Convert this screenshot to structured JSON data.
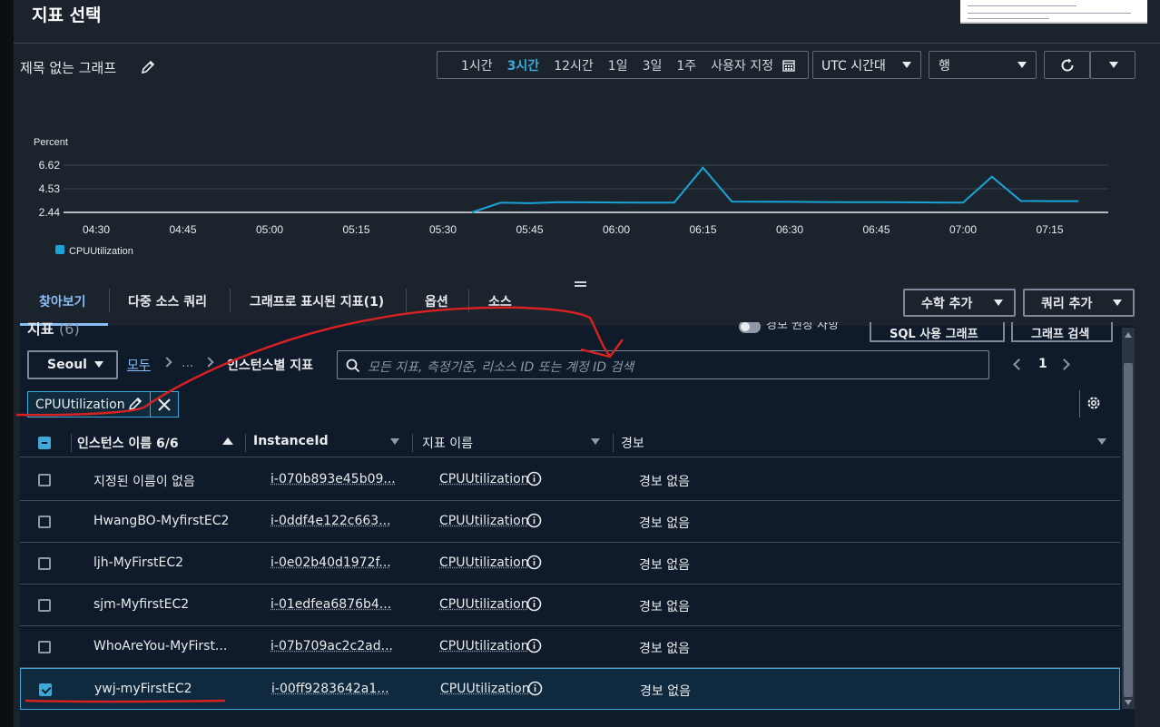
{
  "page": {
    "title": "지표 선택"
  },
  "graph": {
    "title": "제목 없는 그래프"
  },
  "time_ranges": [
    "1시간",
    "3시간",
    "12시간",
    "1일",
    "3일",
    "1주",
    "사용자 지정"
  ],
  "time_range_active": "3시간",
  "timezone": "UTC 시간대",
  "view_type": "행",
  "chart_data": {
    "type": "line",
    "ylabel": "Percent",
    "y_ticks": [
      "2.44",
      "4.53",
      "6.62"
    ],
    "ylim": [
      2.44,
      6.62
    ],
    "x_ticks": [
      "04:30",
      "04:45",
      "05:00",
      "05:15",
      "05:30",
      "05:45",
      "06:00",
      "06:15",
      "06:30",
      "06:45",
      "07:00",
      "07:15"
    ],
    "legend_position": "bottom-left",
    "series": [
      {
        "name": "CPUUtilization",
        "color": "#1aa3d6",
        "x": [
          "05:35",
          "05:40",
          "05:45",
          "05:50",
          "05:55",
          "06:00",
          "06:05",
          "06:10",
          "06:15",
          "06:20",
          "06:25",
          "06:30",
          "06:35",
          "06:40",
          "06:45",
          "06:50",
          "06:55",
          "07:00",
          "07:05",
          "07:10",
          "07:15",
          "07:20"
        ],
        "values": [
          2.44,
          3.3,
          3.25,
          3.35,
          3.33,
          3.32,
          3.31,
          3.3,
          6.4,
          3.4,
          3.38,
          3.37,
          3.36,
          3.35,
          3.34,
          3.33,
          3.32,
          3.31,
          5.6,
          3.45,
          3.44,
          3.44
        ]
      }
    ]
  },
  "tabs": [
    "찾아보기",
    "다중 소스 쿼리",
    "그래프로 표시된 지표(1)",
    "옵션",
    "소스"
  ],
  "actions": {
    "math": "수학 추가",
    "query": "쿼리 추가"
  },
  "panel": {
    "title": "지표",
    "count": "(6)",
    "toggle_label": "경보 권장 사항",
    "sql_button": "SQL 사용 그래프",
    "graph_search_button": "그래프 검색"
  },
  "browse": {
    "region": "Seoul",
    "crumb_all": "모두",
    "crumb_mid": "...",
    "crumb_current": "인스턴스별 지표",
    "search_placeholder": "모든 지표, 측정기준, 리소스 ID 또는 계정 ID 검색",
    "page": "1",
    "token": "CPUUtilization"
  },
  "table": {
    "headers": {
      "name": "인스턴스 이름 6/6",
      "instance": "InstanceId",
      "metric": "지표 이름",
      "alarm": "경보"
    },
    "rows": [
      {
        "name": "지정된 이름이 없음",
        "instance": "i-070b893e45b09...",
        "metric": "CPUUtilization",
        "alarm": "경보 없음",
        "checked": false
      },
      {
        "name": "HwangBO-MyfirstEC2",
        "instance": "i-0ddf4e122c663...",
        "metric": "CPUUtilization",
        "alarm": "경보 없음",
        "checked": false
      },
      {
        "name": "ljh-MyFirstEC2",
        "instance": "i-0e02b40d1972f...",
        "metric": "CPUUtilization",
        "alarm": "경보 없음",
        "checked": false
      },
      {
        "name": "sjm-MyfirstEC2",
        "instance": "i-01edfea6876b4...",
        "metric": "CPUUtilization",
        "alarm": "경보 없음",
        "checked": false
      },
      {
        "name": "WhoAreYou-MyFirst...",
        "instance": "i-07b709ac2c2ad...",
        "metric": "CPUUtilization",
        "alarm": "경보 없음",
        "checked": false
      },
      {
        "name": "ywj-myFirstEC2",
        "instance": "i-00ff9283642a1...",
        "metric": "CPUUtilization",
        "alarm": "경보 없음",
        "checked": true
      }
    ]
  }
}
